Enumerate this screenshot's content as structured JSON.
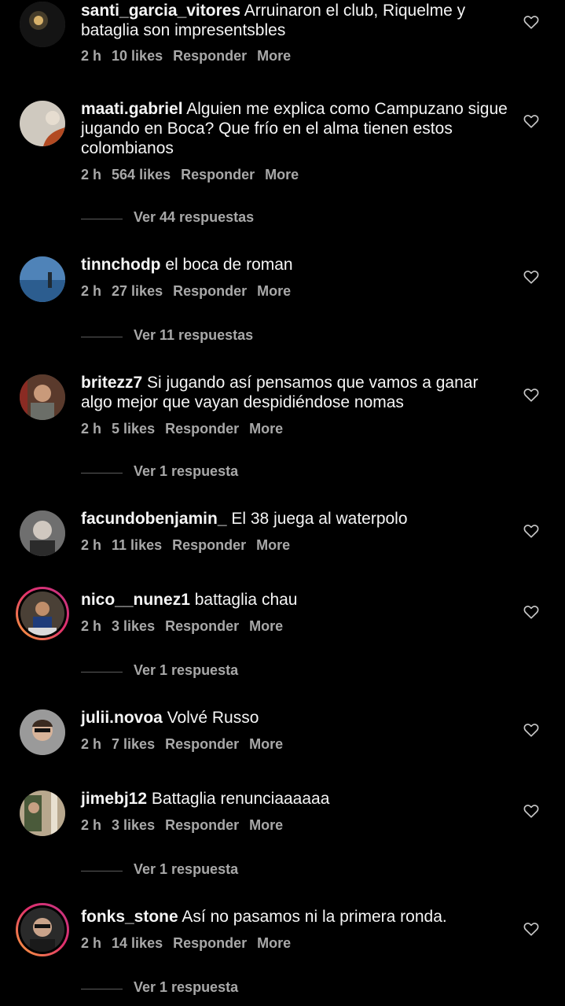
{
  "accent": "#a8a8a8",
  "comments": [
    {
      "user": "santi_garcia_vitores",
      "text": "Arruinaron el club, Riquelme y bataglia son impresentsbles",
      "time": "2 h",
      "likes": "10 likes",
      "reply": "Responder",
      "more": "More"
    },
    {
      "user": "maati.gabriel",
      "text": "Alguien me explica como Campuzano sigue jugando en Boca? Que frío en el alma tienen estos colombianos",
      "time": "2 h",
      "likes": "564 likes",
      "reply": "Responder",
      "more": "More",
      "replies": "Ver 44 respuestas"
    },
    {
      "user": "tinnchodp",
      "text": "el boca de roman",
      "time": "2 h",
      "likes": "27 likes",
      "reply": "Responder",
      "more": "More",
      "replies": "Ver 11 respuestas"
    },
    {
      "user": "britezz7",
      "text": "Si jugando así pensamos que vamos a ganar algo mejor que vayan despidiéndose nomas",
      "time": "2 h",
      "likes": "5 likes",
      "reply": "Responder",
      "more": "More",
      "replies": "Ver 1 respuesta"
    },
    {
      "user": "facundobenjamin_",
      "text": "El 38 juega al waterpolo",
      "time": "2 h",
      "likes": "11 likes",
      "reply": "Responder",
      "more": "More"
    },
    {
      "user": "nico__nunez1",
      "text": "battaglia chau",
      "time": "2 h",
      "likes": "3 likes",
      "reply": "Responder",
      "more": "More",
      "replies": "Ver 1 respuesta"
    },
    {
      "user": "julii.novoa",
      "text": "Volvé Russo",
      "time": "2 h",
      "likes": "7 likes",
      "reply": "Responder",
      "more": "More"
    },
    {
      "user": "jimebj12",
      "text": "Battaglia renunciaaaaaa",
      "time": "2 h",
      "likes": "3 likes",
      "reply": "Responder",
      "more": "More",
      "replies": "Ver 1 respuesta"
    },
    {
      "user": "fonks_stone",
      "text": "Así no pasamos ni la primera ronda.",
      "time": "2 h",
      "likes": "14 likes",
      "reply": "Responder",
      "more": "More",
      "replies": "Ver 1 respuesta"
    }
  ]
}
